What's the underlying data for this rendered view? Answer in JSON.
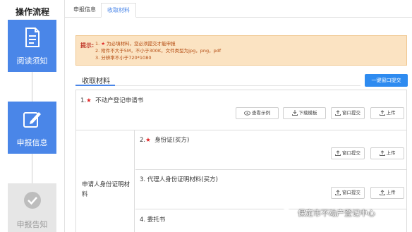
{
  "sidebar": {
    "title": "操作流程",
    "steps": [
      {
        "label": "阅读须知",
        "icon": "document-icon",
        "state": "active"
      },
      {
        "label": "申报信息",
        "icon": "edit-icon",
        "state": "active"
      },
      {
        "label": "申报告知",
        "icon": "check-circle-icon",
        "state": "disabled"
      }
    ]
  },
  "tabs": [
    {
      "label": "申报信息",
      "active": false
    },
    {
      "label": "收取材料",
      "active": true
    }
  ],
  "notice": {
    "label": "提示:",
    "line1_prefix": "1. ",
    "line1_star": "★",
    "line1_text": " 为必填材料，您必须提交才能申报",
    "line2": "2. 附件不大于5M，不小于300K，文件类型为jpg，png，pdf",
    "line3": "3. 分辨率不小于720*1080"
  },
  "section": {
    "title": "收取材料",
    "batch_submit_label": "一键窗口提交"
  },
  "materials": {
    "doc1": {
      "number": "1.",
      "star": "★",
      "name": "不动产登记申请书"
    },
    "doc1_actions": {
      "view_sample": "查看示例",
      "download_template": "下载模板",
      "window_submit": "窗口提交",
      "upload": "上传"
    },
    "group_label": "申请人身份证明材料",
    "doc2": {
      "number": "2.",
      "star": "★",
      "name": "身份证(买方)"
    },
    "doc3": {
      "name": "3. 代理人身份证明材料(买方)"
    },
    "doc4": {
      "name": "4. 委托书"
    },
    "window_submit": "窗口提交",
    "upload": "上传"
  },
  "watermark": "保定市不动产登记中心",
  "colors": {
    "accent": "#4a86e8",
    "button_blue": "#2e8bf0",
    "notice_bg": "#fbe3c2",
    "notice_text": "#b34a10",
    "star": "#e02424"
  }
}
